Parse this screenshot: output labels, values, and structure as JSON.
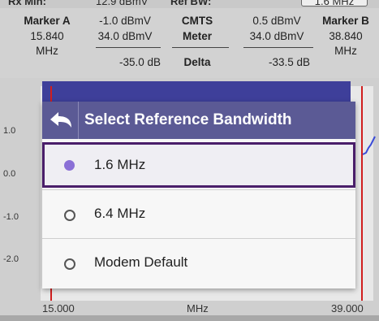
{
  "top_partial": {
    "left_label": "Rx Min:",
    "left_value": "12.9 dBmV",
    "mid_label": "Ref BW:",
    "right_value": "1.6 MHz"
  },
  "info": {
    "marker_a": {
      "title": "Marker A",
      "freq": "15.840",
      "unit": "MHz"
    },
    "col2": {
      "v1": "-1.0 dBmV",
      "v2": "34.0 dBmV",
      "v3": "-35.0 dB"
    },
    "col3": {
      "h1": "CMTS",
      "h2": "Meter",
      "h3": "Delta"
    },
    "col4": {
      "v1": "0.5 dBmV",
      "v2": "34.0 dBmV",
      "v3": "-33.5 dB"
    },
    "marker_b": {
      "title": "Marker B",
      "freq": "38.840",
      "unit": "MHz"
    }
  },
  "graph": {
    "y_labels": [
      "1.0",
      "0.0",
      "-1.0",
      "-2.0"
    ],
    "x_start": "15.000",
    "x_unit": "MHz",
    "x_end": "39.000"
  },
  "dialog": {
    "title": "Select Reference Bandwidth",
    "back_icon": "back-arrow-icon",
    "options": [
      {
        "label": "1.6 MHz",
        "selected": true
      },
      {
        "label": "6.4 MHz",
        "selected": false
      },
      {
        "label": "Modem Default",
        "selected": false
      }
    ],
    "accent_color": "#8a6fd6",
    "header_color": "#5b5a95"
  }
}
